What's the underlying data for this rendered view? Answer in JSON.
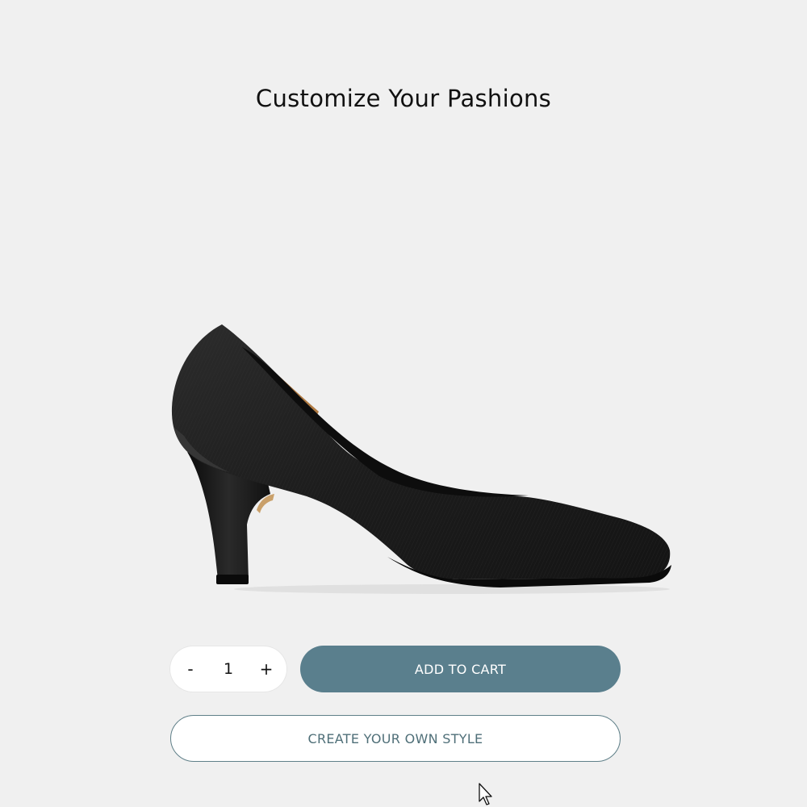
{
  "page": {
    "title": "Customize Your Pashions",
    "background": "#f0f0f0"
  },
  "product": {
    "image_icon": "black-pointed-toe-pump-shoe",
    "quantity": "1",
    "decrement_label": "-",
    "increment_label": "+"
  },
  "actions": {
    "add_to_cart_label": "ADD TO CART",
    "create_style_label": "CREATE YOUR OWN STYLE"
  },
  "colors": {
    "primary_button": "#5a7f8d",
    "outline_button_border": "#5f7f88",
    "outline_button_text": "#4f6f78"
  },
  "cursor": {
    "icon": "arrow-pointer-icon"
  }
}
